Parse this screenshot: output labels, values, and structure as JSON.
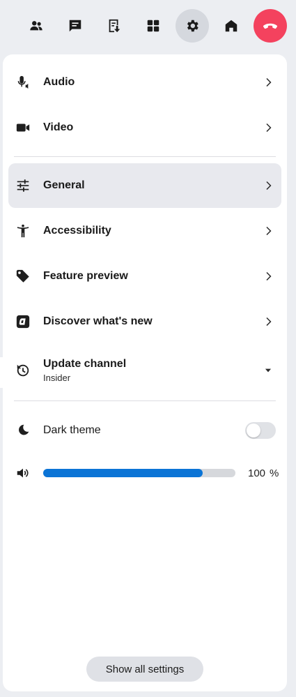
{
  "toolbar": {
    "buttons": [
      {
        "name": "people-button",
        "icon": "people-icon"
      },
      {
        "name": "chat-button",
        "icon": "chat-icon"
      },
      {
        "name": "captions-button",
        "icon": "captions-icon"
      },
      {
        "name": "layout-button",
        "icon": "grid-icon"
      },
      {
        "name": "settings-button",
        "icon": "gear-icon",
        "active": true
      },
      {
        "name": "home-button",
        "icon": "home-icon"
      },
      {
        "name": "hangup-button",
        "icon": "phone-hangup-icon",
        "color": "#f4425e"
      }
    ]
  },
  "menu": {
    "audio": "Audio",
    "video": "Video",
    "general": "General",
    "accessibility": "Accessibility",
    "feature_preview": "Feature preview",
    "discover": "Discover what's new",
    "update_channel": "Update channel",
    "update_channel_value": "Insider",
    "dark_theme": "Dark theme",
    "dark_theme_on": false
  },
  "volume": {
    "value": "100",
    "unit": "%",
    "level": 0.83,
    "accent": "#0b74d6"
  },
  "footer": {
    "show_all": "Show all settings"
  }
}
